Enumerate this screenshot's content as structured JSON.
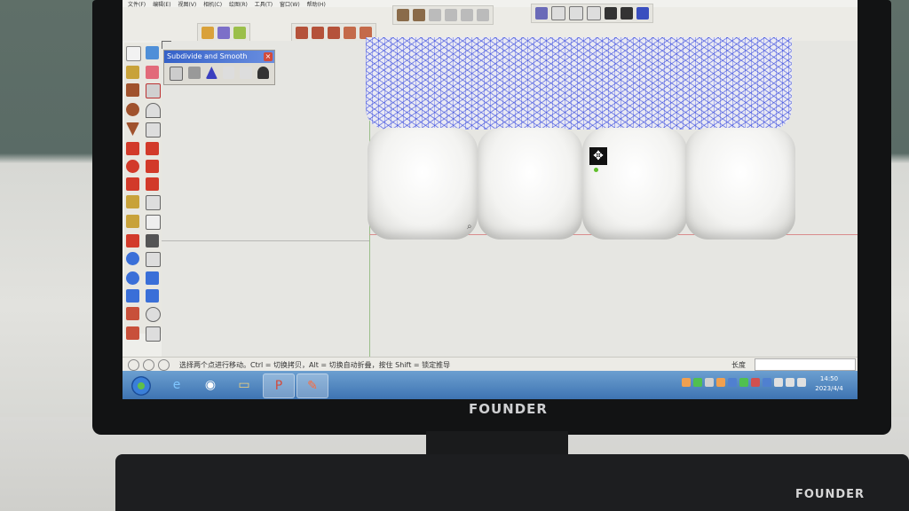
{
  "app": {
    "menu_items": [
      "文件(F)",
      "编辑(E)",
      "视图(V)",
      "相机(C)",
      "绘图(R)",
      "工具(T)",
      "窗口(W)",
      "帮助(H)"
    ]
  },
  "panel": {
    "title": "Subdivide and Smooth",
    "close_label": "×",
    "icons": [
      "cube-icon",
      "smooth-icon",
      "triangle-icon",
      "crease-icon",
      "knife-icon",
      "weight-icon"
    ]
  },
  "canvas": {
    "tooth_count": 4,
    "mesh_color": "#2a3cdc"
  },
  "statusbar": {
    "hint": "选择两个点进行移动。Ctrl = 切换拷贝，Alt = 切换自动折叠，按住 Shift = 锁定推导",
    "measure_label": "长度",
    "measure_value": ""
  },
  "taskbar": {
    "apps": [
      "start",
      "ie-icon",
      "chrome-icon",
      "explorer-icon",
      "powerpoint-icon",
      "sketchup-icon"
    ],
    "time": "14:50",
    "date": "2023/4/4"
  },
  "hardware": {
    "monitor_brand": "FOUNDER",
    "keyboard_brand": "FOUNDER"
  }
}
